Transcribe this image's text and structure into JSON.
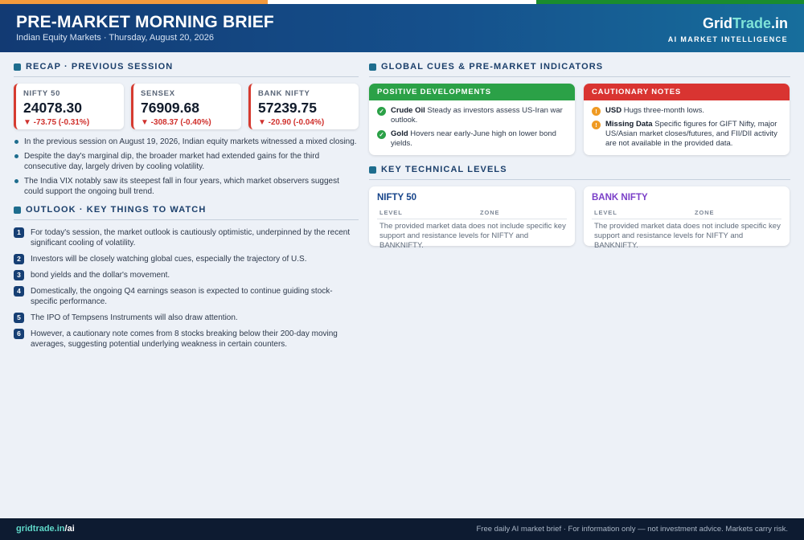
{
  "header": {
    "title": "PRE-MARKET MORNING BRIEF",
    "subtitle": "Indian Equity Markets · Thursday, August 20, 2026",
    "brand_part1": "Grid",
    "brand_part2": "Trade",
    "brand_part3": ".in",
    "brand_tagline": "AI MARKET INTELLIGENCE"
  },
  "recap": {
    "heading": "RECAP · PREVIOUS SESSION",
    "indices": [
      {
        "name": "NIFTY 50",
        "value": "24078.30",
        "change": "▼ -73.75 (-0.31%)"
      },
      {
        "name": "SENSEX",
        "value": "76909.68",
        "change": "▼ -308.37 (-0.40%)"
      },
      {
        "name": "BANK NIFTY",
        "value": "57239.75",
        "change": "▼ -20.90 (-0.04%)"
      }
    ],
    "bullets": [
      "In the previous session on August 19, 2026, Indian equity markets witnessed a mixed closing.",
      "Despite the day's marginal dip, the broader market had extended gains for the third consecutive day, largely driven by cooling volatility.",
      "The India VIX notably saw its steepest fall in four years, which market observers suggest could support the ongoing bull trend."
    ]
  },
  "outlook": {
    "heading": "OUTLOOK · KEY THINGS TO WATCH",
    "items": [
      {
        "num": "1",
        "text": "For today's session, the market outlook is cautiously optimistic, underpinned by the recent significant cooling of volatility."
      },
      {
        "num": "2",
        "text": "Investors will be closely watching global cues, especially the trajectory of U.S."
      },
      {
        "num": "3",
        "text": "bond yields and the dollar's movement."
      },
      {
        "num": "4",
        "text": "Domestically, the ongoing Q4 earnings season is expected to continue guiding stock-specific performance."
      },
      {
        "num": "5",
        "text": "The IPO of Tempsens Instruments will also draw attention."
      },
      {
        "num": "6",
        "text": "However, a cautionary note comes from 8 stocks breaking below their 200-day moving averages, suggesting potential underlying weakness in certain counters."
      }
    ]
  },
  "global": {
    "heading": "GLOBAL CUES & PRE-MARKET INDICATORS",
    "positive": {
      "title": "POSITIVE DEVELOPMENTS",
      "items": [
        {
          "label": "Crude Oil",
          "text": "Steady as investors assess US-Iran war outlook."
        },
        {
          "label": "Gold",
          "text": "Hovers near early-June high on lower bond yields."
        }
      ]
    },
    "cautionary": {
      "title": "CAUTIONARY NOTES",
      "items": [
        {
          "label": "USD",
          "text": "Hugs three-month lows."
        },
        {
          "label": "Missing Data",
          "text": "Specific figures for GIFT Nifty, major US/Asian market closes/futures, and FII/DII activity are not available in the provided data."
        }
      ]
    }
  },
  "technical": {
    "heading": "KEY TECHNICAL LEVELS",
    "cards": [
      {
        "title": "NIFTY 50",
        "col_level": "LEVEL",
        "col_zone": "ZONE",
        "note": "The provided market data does not include specific key support and resistance levels for NIFTY and BANKNIFTY."
      },
      {
        "title": "BANK NIFTY",
        "col_level": "LEVEL",
        "col_zone": "ZONE",
        "note": "The provided market data does not include specific key support and resistance levels for NIFTY and BANKNIFTY."
      }
    ]
  },
  "footer": {
    "brand_part1": "gridtrade.in",
    "brand_part2": "/ai",
    "note": "Free daily AI market brief · For information only — not investment advice. Markets carry risk."
  },
  "colors": {
    "header_blue": "#15508c",
    "accent_teal": "#1e6d8e",
    "positive_green": "#2ba147",
    "negative_red": "#d93431",
    "warn_orange": "#ef9a23"
  }
}
